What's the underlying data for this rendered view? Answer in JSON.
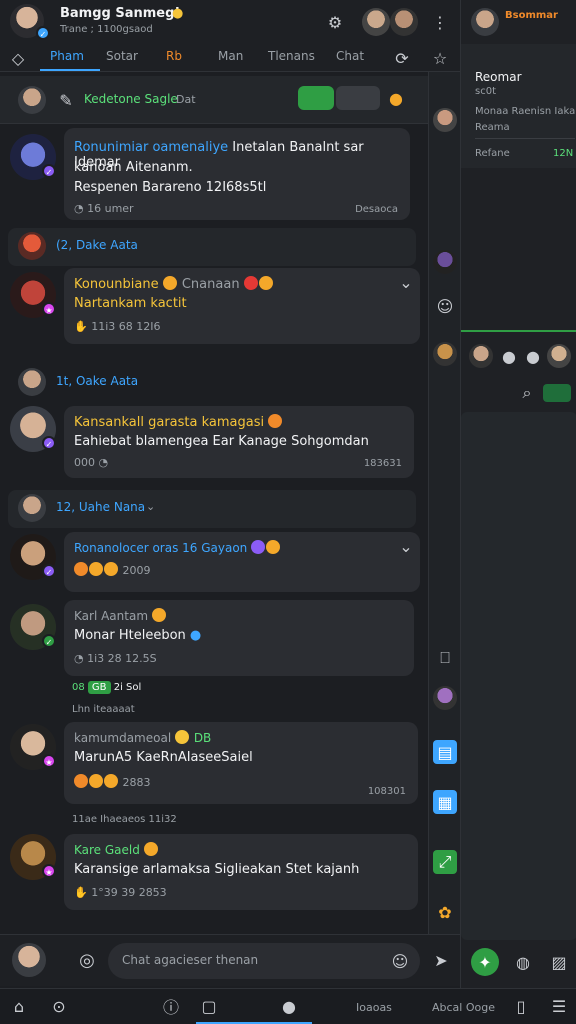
{
  "header": {
    "title": "Bamgg Sanmeg!",
    "subtitle": "Trane ; 1100gsaod",
    "tabs": [
      "Pham",
      "Sotar",
      "Man",
      "Tlenans",
      "Chat"
    ],
    "tab_badge": "Rb"
  },
  "pinned": {
    "label": "Kedetone Sagle",
    "sublabel": "Dat"
  },
  "messages": [
    {
      "author": "Ronunimiar oamenaliye",
      "line1": "Inetalan Banalnt sar Idemar",
      "line2": "kanoan Aitenanm.",
      "line3": "Respenen Barareno 12I68s5tl",
      "meta": "16 umer",
      "time": "Desaoca"
    },
    {
      "divider": "(2, Dake Aata"
    },
    {
      "author": "Konounbiane",
      "author2": "Cnanaan",
      "line1": "Nartankam kactit",
      "meta": "11i3 68 12I6",
      "time": ""
    },
    {
      "divider": "1t, Oake Aata"
    },
    {
      "author": "Kansankall garasta kamagasi",
      "line1": "Eahiebat blamengea Ear Kanage Sohgomdan",
      "meta": "000",
      "time": "183631"
    },
    {
      "divider": "12, Uahe Nana"
    },
    {
      "author": "Ronanolocer oras 16 Gayaon",
      "line1": "",
      "meta": "2009",
      "time": ""
    },
    {
      "author": "Karl Aantam",
      "line1": "Monar Hteleebon",
      "meta": "1i3 28 12.5S",
      "time": ""
    },
    {
      "chip": "08",
      "chip2": "2i Sol",
      "divider2": "Lhn iteaaaat"
    },
    {
      "author": "kamumdameoal",
      "author_tag": "DB",
      "line1": "MarunA5 KaeRnAIaseeSaiel",
      "meta": "2883",
      "time": "108301"
    },
    {
      "divider": "11ae Ihaeaeos 11i32"
    },
    {
      "author": "Kare Gaeld",
      "line1": "Karansige arlamaksa Siglieakan Stet kajanh",
      "meta": "1°39 39 2853",
      "time": ""
    }
  ],
  "composer": {
    "placeholder": "Chat agacieser thenan"
  },
  "bottom_nav": {
    "item1": "Ioaoas",
    "item2": "Abcal Ooge"
  },
  "right_panel": {
    "title": "Bsommar",
    "section_title": "Reomar",
    "line1": "sc0t",
    "line2": "Monaa Raenisn Iaka",
    "line3": "Reama",
    "field": "Refane",
    "value": "12N"
  }
}
